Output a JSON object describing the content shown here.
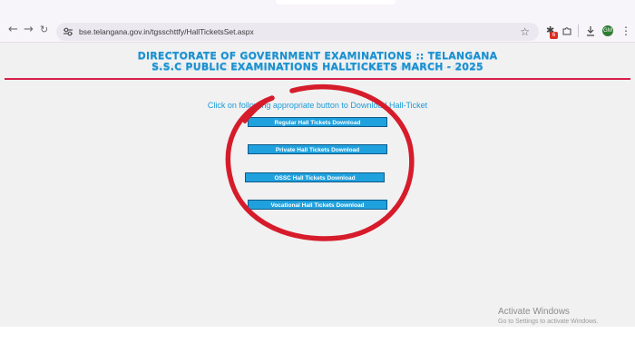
{
  "browser": {
    "url": "bse.telangana.gov.in/tgsschttfy/HallTicketsSet.aspx",
    "nav": {
      "back": "←",
      "forward": "→",
      "reload": "C"
    },
    "extension_badge": "6",
    "profile_initials": "GM"
  },
  "page": {
    "header_line1": "DIRECTORATE OF GOVERNMENT EXAMINATIONS :: TELANGANA",
    "header_line2": "S.S.C PUBLIC EXAMINATIONS HALLTICKETS MARCH - 2025",
    "header_reflection": "S.S.C PUBLIC EXAMINATIONS HALLTICKETS MARCH - 2025",
    "instruction": "Click on following appropriate button to Download Hall-Ticket",
    "buttons": {
      "regular": "Regular Hall Tickets Download",
      "private": "Private Hall Tickets Download",
      "ossc": "OSSC Hall Tickets Download",
      "vocational": "Vocational Hall Tickets Download"
    }
  },
  "watermark": {
    "title": "Activate Windows",
    "subtitle": "Go to Settings to activate Windows."
  },
  "colors": {
    "header": "#1b8fce",
    "red_line": "#d6204a",
    "button": "#1fa1de",
    "annotation": "#d61c2b"
  }
}
